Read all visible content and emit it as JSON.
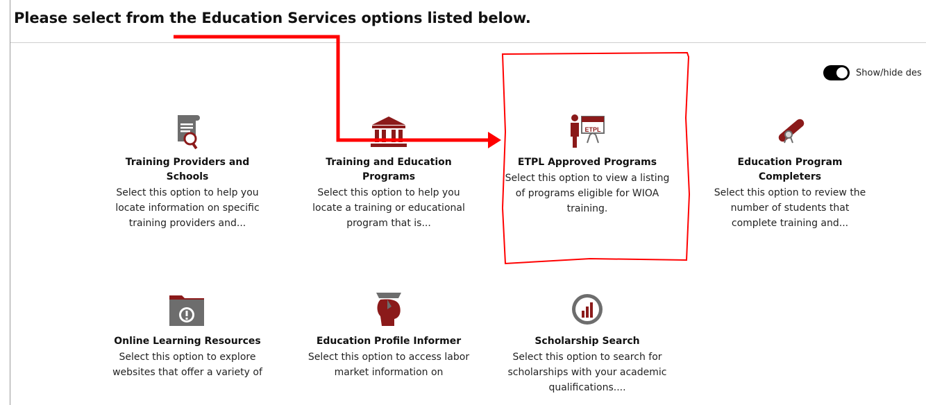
{
  "header": {
    "title": "Please select from the Education Services options listed below."
  },
  "toggle": {
    "label": "Show/hide des"
  },
  "cards": [
    {
      "title": "Training Providers and Schools",
      "desc": "Select this option to help you locate information on specific training providers and...",
      "icon": "scroll-magnifier-icon"
    },
    {
      "title": "Training and Education Programs",
      "desc": "Select this option to help you locate a training or educational program that is...",
      "icon": "building-columns-icon"
    },
    {
      "title": "ETPL Approved Programs",
      "desc": "Select this option to view a listing of programs eligible for WIOA training.",
      "icon": "presenter-board-icon"
    },
    {
      "title": "Education Program Completers",
      "desc": "Select this option to review the number of students that complete training and...",
      "icon": "diploma-icon"
    },
    {
      "title": "Online Learning Resources",
      "desc": "Select this option to explore websites that offer a variety of",
      "icon": "folder-alert-icon"
    },
    {
      "title": "Education Profile Informer",
      "desc": "Select this option to access labor market information on",
      "icon": "graduate-head-icon"
    },
    {
      "title": "Scholarship Search",
      "desc": "Select this option to search for scholarships with your academic qualifications....",
      "icon": "chart-circle-icon"
    }
  ],
  "colors": {
    "accent": "#8b1a1a",
    "annotation": "#ff0000",
    "icon_gray": "#6d6d6d"
  }
}
